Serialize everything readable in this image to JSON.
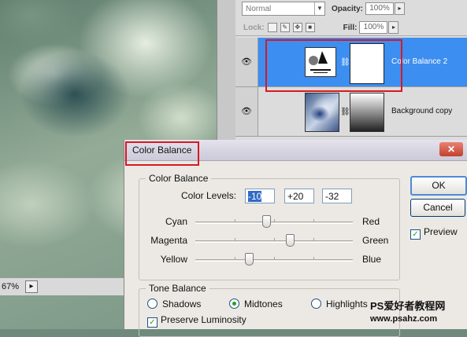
{
  "canvas": {
    "zoom": "67%"
  },
  "layers_panel": {
    "blend_mode": "Normal",
    "opacity_label": "Opacity:",
    "opacity_value": "100%",
    "lock_label": "Lock:",
    "fill_label": "Fill:",
    "fill_value": "100%",
    "layers": [
      {
        "name": "Color Balance 2",
        "selected": true
      },
      {
        "name": "Background copy",
        "selected": false
      }
    ]
  },
  "dialog": {
    "title": "Color Balance",
    "close_glyph": "✕",
    "color_balance_group": "Color Balance",
    "color_levels_label": "Color Levels:",
    "levels": [
      "-10",
      "+20",
      "-32"
    ],
    "sliders": [
      {
        "left": "Cyan",
        "right": "Red",
        "value": -10
      },
      {
        "left": "Magenta",
        "right": "Green",
        "value": 20
      },
      {
        "left": "Yellow",
        "right": "Blue",
        "value": -32
      }
    ],
    "slider_range": [
      -100,
      100
    ],
    "tone_balance_group": "Tone Balance",
    "tones": [
      "Shadows",
      "Midtones",
      "Highlights"
    ],
    "selected_tone": "Midtones",
    "preserve_luminosity": "Preserve Luminosity",
    "ok": "OK",
    "cancel": "Cancel",
    "preview": "Preview",
    "check_glyph": "✓"
  },
  "watermark": {
    "line1": "PS爱好者教程网",
    "line2": "www.psahz.com"
  },
  "colors": {
    "selection": "#3c8ef1",
    "highlight_box": "#d71920",
    "check": "#21a121"
  }
}
